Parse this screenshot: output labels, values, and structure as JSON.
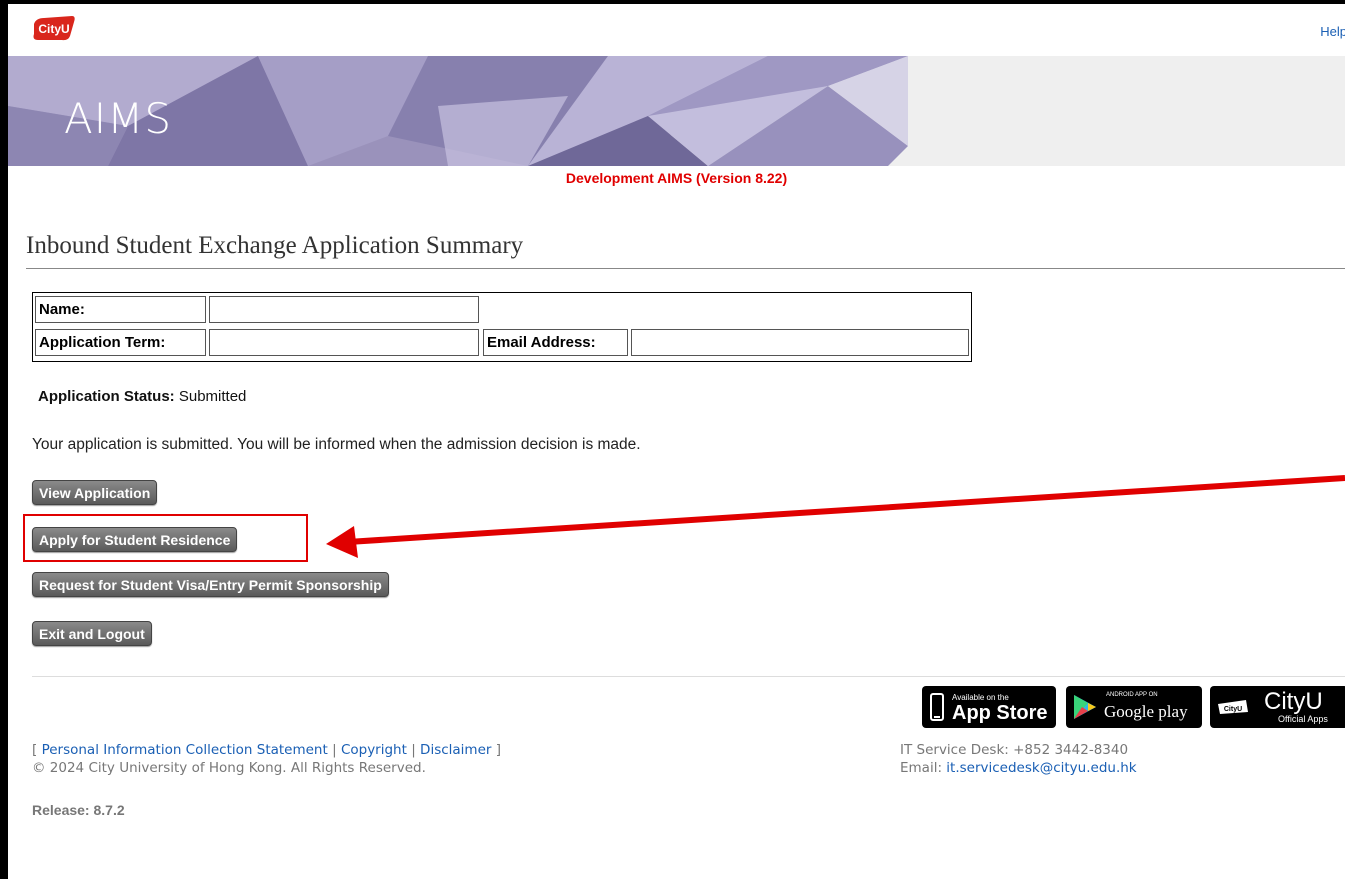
{
  "header": {
    "logo_text": "CityU",
    "help_label": "Help"
  },
  "banner": {
    "title": "AIMS"
  },
  "dev_version": "Development AIMS (Version 8.22)",
  "page_title": "Inbound Student Exchange Application Summary",
  "info": {
    "name_label": "Name:",
    "name_value": "",
    "term_label": "Application Term:",
    "term_value": "",
    "email_label": "Email Address:",
    "email_value": ""
  },
  "status": {
    "label": "Application Status:",
    "value": "Submitted"
  },
  "message": "Your application is submitted. You will be informed when the admission decision is made.",
  "buttons": {
    "view_application": "View Application",
    "apply_residence": "Apply for Student Residence",
    "request_visa": "Request for Student Visa/Entry Permit Sponsorship",
    "exit_logout": "Exit and Logout"
  },
  "badges": {
    "appstore_small": "Available on the",
    "appstore_big": "App Store",
    "googleplay_small": "ANDROID APP ON",
    "googleplay_big": "Google play",
    "cityu_big": "CityU",
    "cityu_small": "Official Apps"
  },
  "footer": {
    "bracket_open": "[ ",
    "link_pics": "Personal Information Collection Statement",
    "sep1": " | ",
    "link_copyright": "Copyright",
    "sep2": " | ",
    "link_disclaimer": "Disclaimer",
    "bracket_close": " ]",
    "copyright": "© 2024 City University of Hong Kong. All Rights Reserved.",
    "release": "Release: 8.7.2",
    "service_desk": "IT Service Desk: +852 3442-8340",
    "email_label": "Email: ",
    "email_value": "it.servicedesk@cityu.edu.hk"
  },
  "colors": {
    "accent_red": "#e00000",
    "link_blue": "#1a5fb4",
    "banner_purple": "#8e86b0"
  }
}
